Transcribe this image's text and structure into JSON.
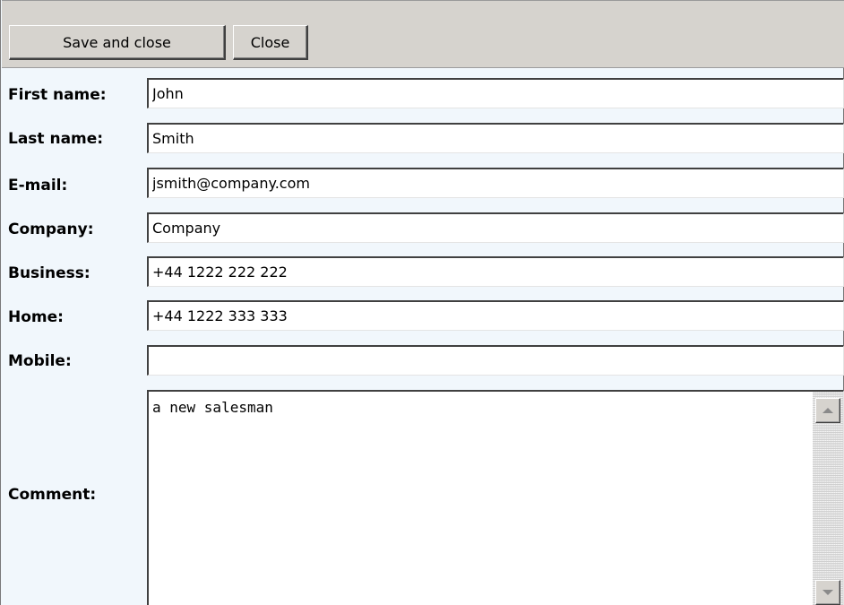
{
  "toolbar": {
    "save_close_label": "Save and close",
    "close_label": "Close"
  },
  "form": {
    "first_name": {
      "label": "First name:",
      "value": "John"
    },
    "last_name": {
      "label": "Last name:",
      "value": "Smith"
    },
    "email": {
      "label": "E-mail:",
      "value": "jsmith@company.com"
    },
    "company": {
      "label": "Company:",
      "value": "Company"
    },
    "business": {
      "label": "Business:",
      "value": "+44 1222 222 222"
    },
    "home": {
      "label": "Home:",
      "value": "+44 1222 333 333"
    },
    "mobile": {
      "label": "Mobile:",
      "value": ""
    },
    "comment": {
      "label": "Comment:",
      "value": "a new salesman"
    }
  },
  "colors": {
    "toolbar_bg": "#d6d3ce",
    "form_bg": "#f1f7fc",
    "field_bg": "#ffffff"
  }
}
